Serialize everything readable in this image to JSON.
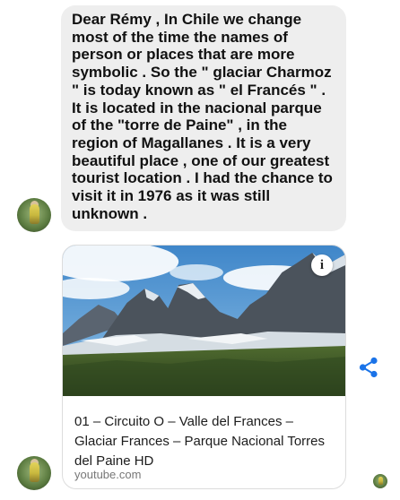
{
  "message": {
    "text": "Dear Rémy , In Chile we change most of the time the names of person or places that are more symbolic . So the \" glaciar Charmoz \" is today known as \" el Francés \" . It is located in the nacional parque of the \"torre de Paine\" , in the region of Magallanes . It is a very beautiful place , one of our greatest tourist location . I had the chance to visit it in 1976 as it was still unknown ."
  },
  "link_preview": {
    "title": "01 – Circuito O – Valle del Frances – Glaciar Frances – Parque Nacional Torres del Paine HD",
    "domain": "youtube.com",
    "info_glyph": "i",
    "thumbnail_icon": "mountain-landscape-thumbnail"
  },
  "icons": {
    "share": "share-icon",
    "info": "info-icon",
    "avatar": "sender-avatar"
  },
  "colors": {
    "bubble_bg": "#eeeeee",
    "share_accent": "#1a73e8"
  }
}
